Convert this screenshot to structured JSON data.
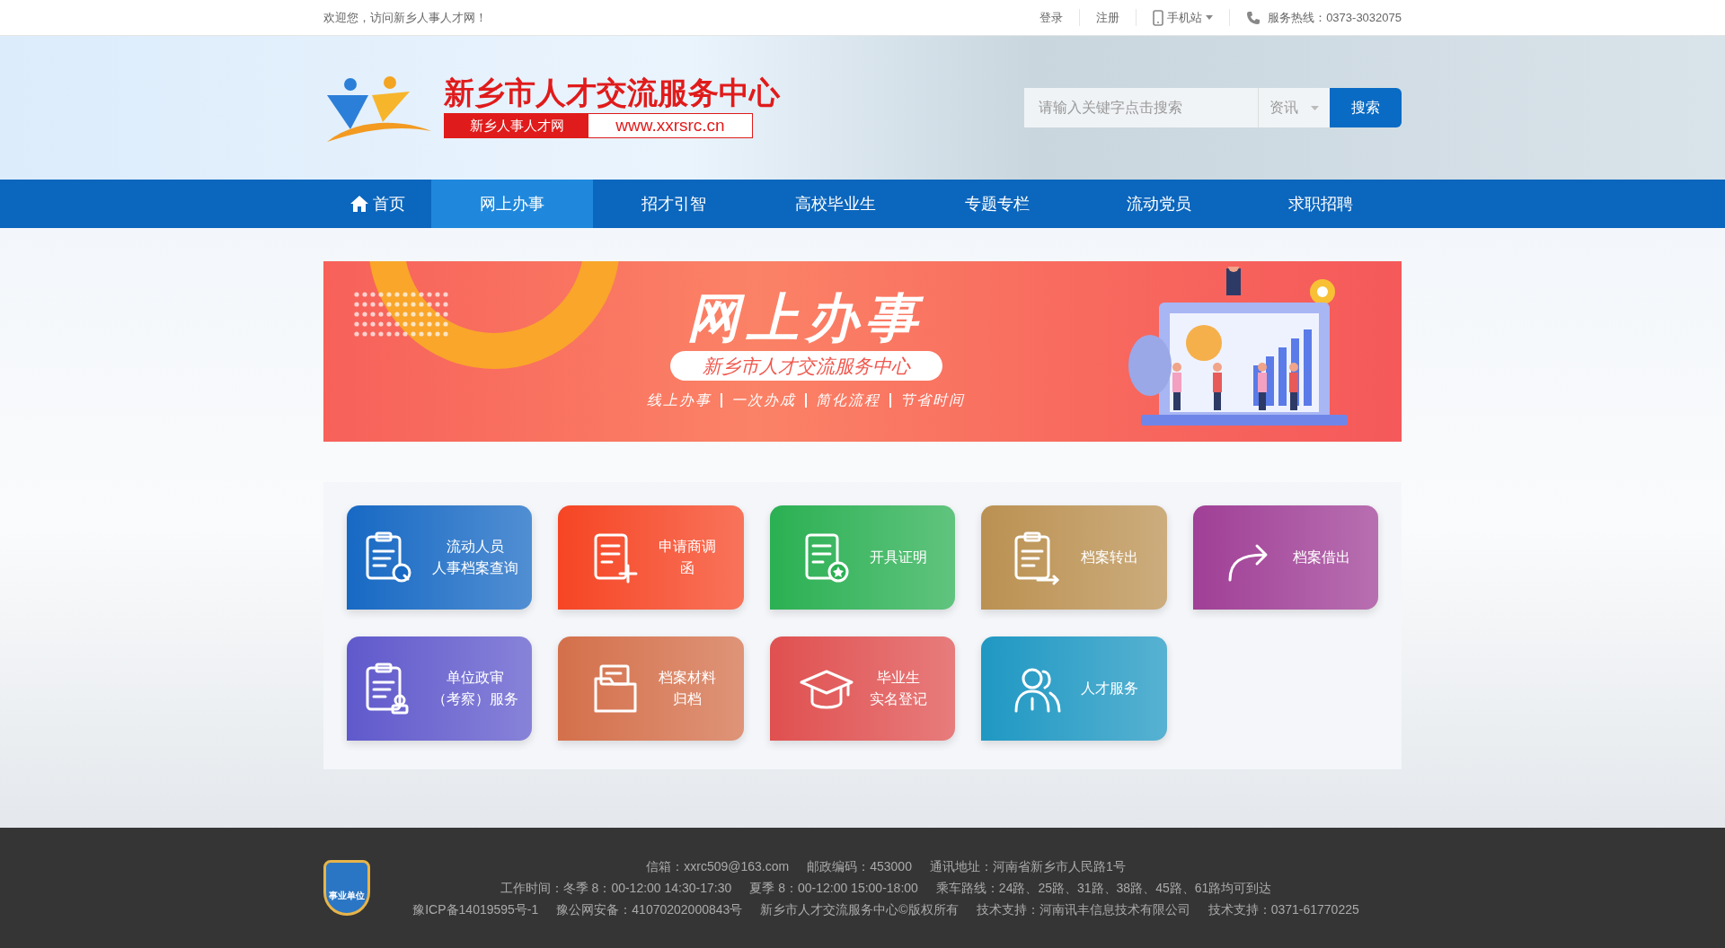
{
  "topbar": {
    "welcome": "欢迎您，访问新乡人事人才网！",
    "links": [
      {
        "label": "登录"
      },
      {
        "label": "注册"
      }
    ],
    "mobile": "手机站",
    "hotline": "服务热线：0373-3032075"
  },
  "header": {
    "title": "新乡市人才交流服务中心",
    "tag": "新乡人事人才网",
    "url": "www.xxrsrc.cn",
    "search": {
      "placeholder": "请输入关键字点击搜索",
      "category": "资讯",
      "button": "搜索"
    }
  },
  "nav": [
    {
      "label": "首页",
      "selected": false,
      "home": true
    },
    {
      "label": "网上办事",
      "selected": true,
      "home": false
    },
    {
      "label": "招才引智",
      "selected": false,
      "home": false
    },
    {
      "label": "高校毕业生",
      "selected": false,
      "home": false
    },
    {
      "label": "专题专栏",
      "selected": false,
      "home": false
    },
    {
      "label": "流动党员",
      "selected": false,
      "home": false
    },
    {
      "label": "求职招聘",
      "selected": false,
      "home": false
    }
  ],
  "banner": {
    "title": "网上办事",
    "subtitle": "新乡市人才交流服务中心",
    "slogans": [
      "线上办事",
      "一次办成",
      "简化流程",
      "节省时间"
    ]
  },
  "tiles": [
    {
      "kind": "search",
      "lines": [
        "流动人员",
        "人事档案查询"
      ],
      "color": "#1769c4"
    },
    {
      "kind": "add",
      "lines": [
        "申请商调",
        "函"
      ],
      "color": "#f64524"
    },
    {
      "kind": "star",
      "lines": [
        "开具证明"
      ],
      "color": "#2bb053"
    },
    {
      "kind": "transfer",
      "lines": [
        "档案转出"
      ],
      "color": "#bb9152"
    },
    {
      "kind": "lend",
      "lines": [
        "档案借出"
      ],
      "color": "#a03f96"
    },
    {
      "kind": "stamp",
      "lines": [
        "单位政审",
        "（考察）服务"
      ],
      "color": "#6059cc"
    },
    {
      "kind": "folder",
      "lines": [
        "档案材料",
        "归档"
      ],
      "color": "#d4704b"
    },
    {
      "kind": "cap",
      "lines": [
        "毕业生",
        "实名登记"
      ],
      "color": "#e05050"
    },
    {
      "kind": "people",
      "lines": [
        "人才服务"
      ],
      "color": "#1f98c3"
    }
  ],
  "footer": {
    "badge": "事业单位",
    "lines": [
      [
        "信箱：xxrc509@163.com",
        "邮政编码：453000",
        "通讯地址：河南省新乡市人民路1号"
      ],
      [
        "工作时间：冬季 8：00-12:00 14:30-17:30",
        "夏季 8：00-12:00 15:00-18:00",
        "乘车路线：24路、25路、31路、38路、45路、61路均可到达"
      ],
      [
        "豫ICP备14019595号-1",
        "豫公网安备：41070202000843号",
        "新乡市人才交流服务中心©版权所有",
        "技术支持：河南讯丰信息技术有限公司",
        "技术支持：0371-61770225"
      ]
    ]
  }
}
